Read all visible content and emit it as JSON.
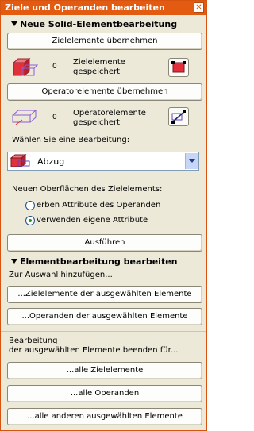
{
  "window": {
    "title": "Ziele und Operanden bearbeiten",
    "close_glyph": "✕"
  },
  "section1": {
    "title": "Neue Solid-Elementbearbeitung",
    "targets_button": "Zielelemente übernehmen",
    "targets_count": "0",
    "targets_saved_line1": "Zielelemente",
    "targets_saved_line2": "gespeichert",
    "operators_button": "Operatorelemente übernehmen",
    "operators_count": "0",
    "operators_saved_line1": "Operatorelemente",
    "operators_saved_line2": "gespeichert",
    "choose_label": "Wählen Sie eine Bearbeitung:",
    "operation_selected": "Abzug",
    "surfaces_label": "Neuen Oberflächen des Zielelements:",
    "radio_option_1": "erben Attribute des Operanden",
    "radio_option_2": "verwenden eigene Attribute",
    "execute_button": "Ausführen"
  },
  "section2": {
    "title": "Elementbearbeitung bearbeiten",
    "add_label": "Zur Auswahl hinzufügen...",
    "add_targets_button": "...Zielelemente der ausgewählten Elemente",
    "add_operands_button": "...Operanden der ausgewählten Elemente",
    "end_label_line1": "Bearbeitung",
    "end_label_line2": "der ausgewählten Elemente beenden für...",
    "end_all_targets_button": "...alle Zielelemente",
    "end_all_operands_button": "...alle Operanden",
    "end_all_others_button": "...alle anderen ausgewählten Elemente"
  },
  "icons": {
    "targets_icon": "red-box-icon",
    "operators_icon": "outline-box-icon",
    "pick_targets_icon": "target-pick-icon",
    "pick_operators_icon": "operator-pick-icon",
    "operation_icon": "subtract-solid-icon"
  },
  "colors": {
    "title_bar": "#e35b10",
    "target_red": "#e0303c",
    "operator_outline": "#8a5cd8"
  }
}
